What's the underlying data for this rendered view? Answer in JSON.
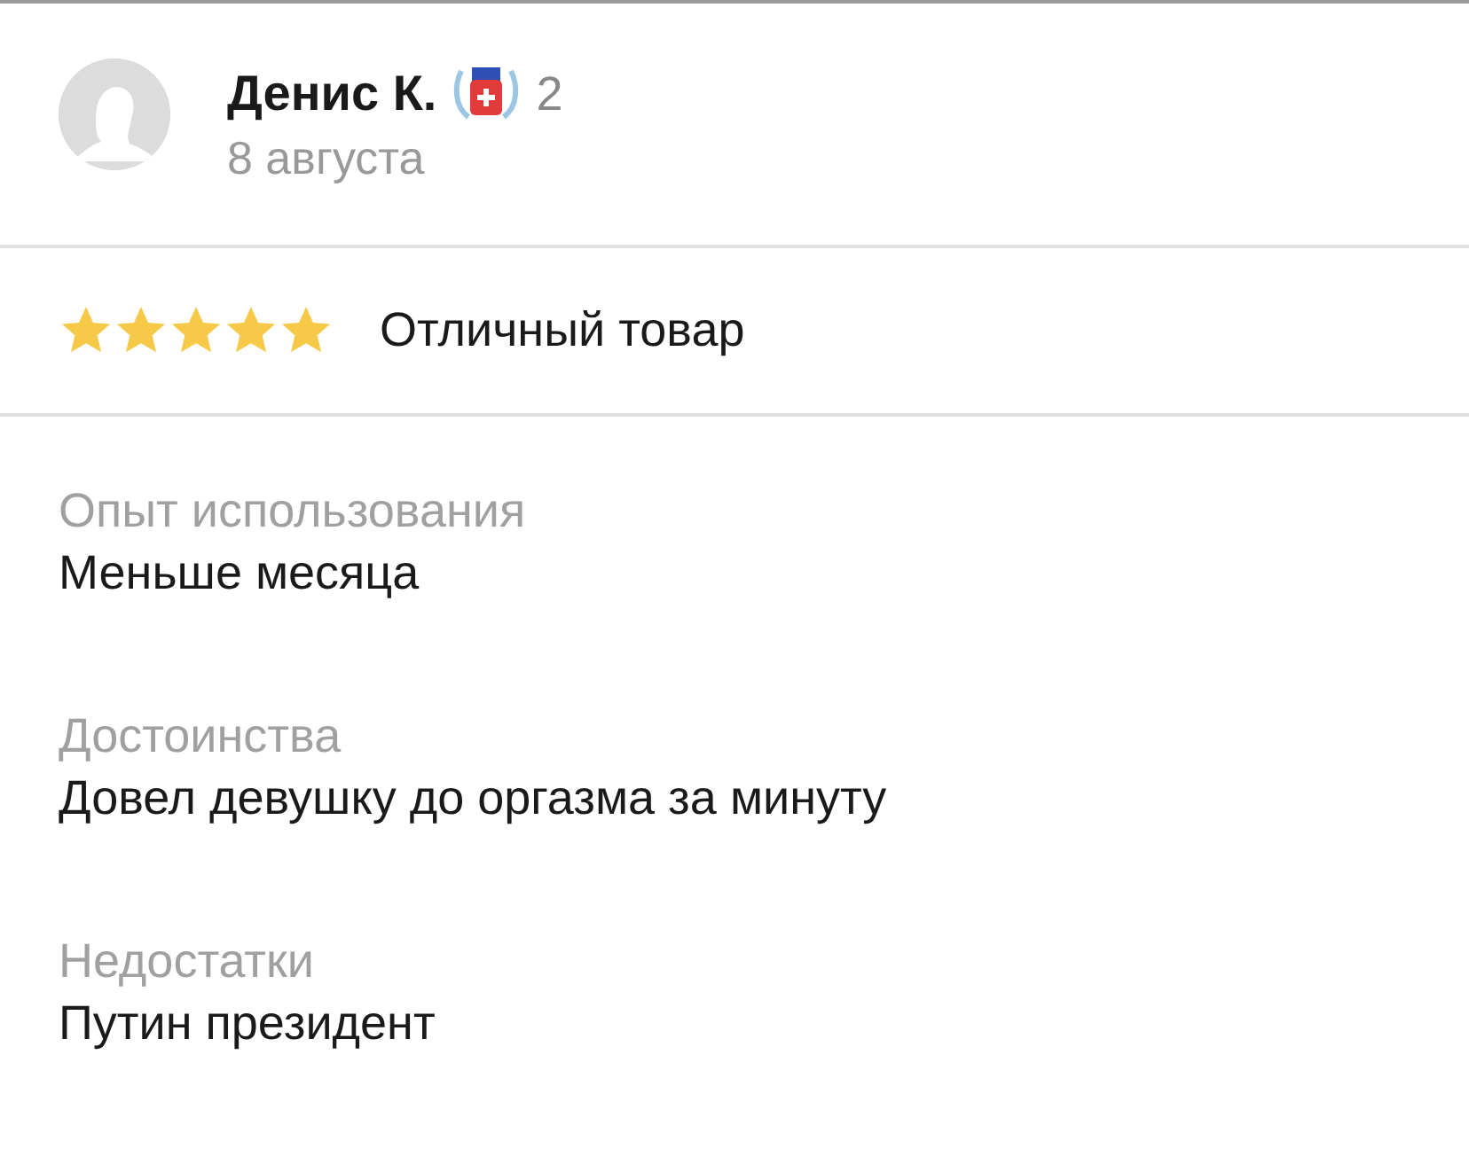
{
  "author": {
    "name": "Денис К.",
    "level": "2",
    "date": "8 августа"
  },
  "rating": {
    "stars": 5,
    "title": "Отличный товар"
  },
  "sections": [
    {
      "label": "Опыт использования",
      "text": "Меньше месяца"
    },
    {
      "label": "Достоинства",
      "text": "Довел девушку до оргазма за минуту"
    },
    {
      "label": "Недостатки",
      "text": "Путин президент"
    }
  ]
}
